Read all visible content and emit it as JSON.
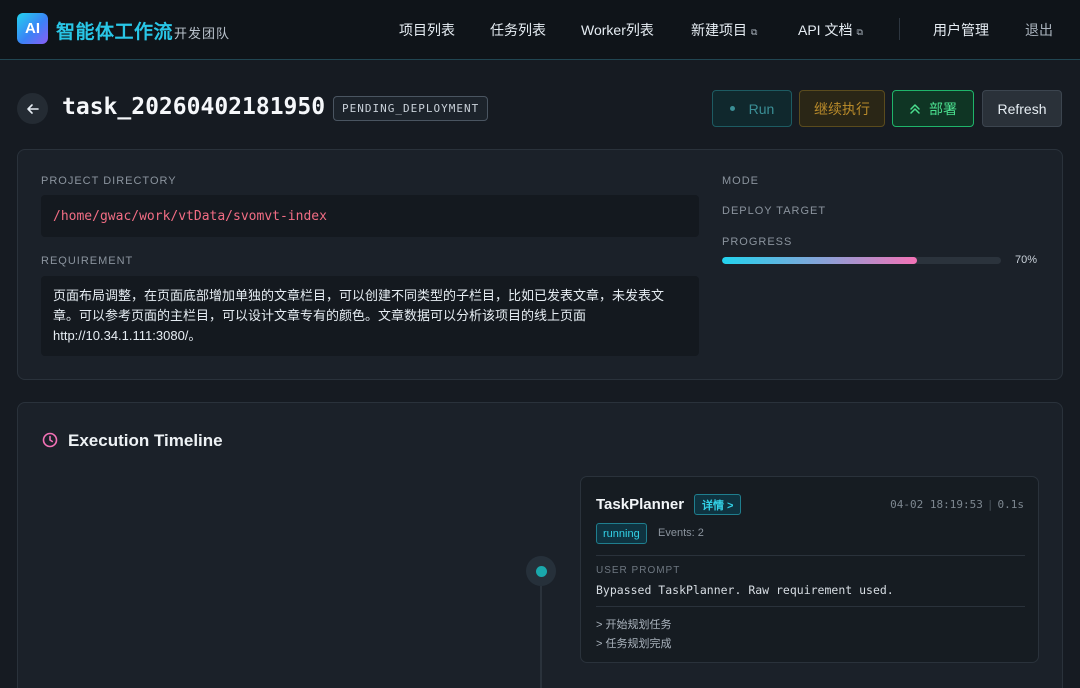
{
  "brand": {
    "logo_text": "AI",
    "title": "智能体工作流",
    "subtitle": "开发团队"
  },
  "nav": {
    "items": [
      {
        "label": "项目列表",
        "external": false
      },
      {
        "label": "任务列表",
        "external": false
      },
      {
        "label": "Worker列表",
        "external": false
      },
      {
        "label": "新建项目",
        "external": true
      },
      {
        "label": "API 文档",
        "external": true
      },
      {
        "label": "用户管理",
        "external": false
      },
      {
        "label": "退出",
        "external": false
      }
    ],
    "external_icon": "⧉"
  },
  "task": {
    "id": "task_20260402181950",
    "status": "PENDING_DEPLOYMENT",
    "actions": {
      "run": "Run",
      "continue": "继续执行",
      "deploy": "部署",
      "refresh": "Refresh"
    }
  },
  "info": {
    "project_directory_label": "PROJECT DIRECTORY",
    "project_directory": "/home/gwac/work/vtData/svomvt-index",
    "requirement_label": "REQUIREMENT",
    "requirement_lines": [
      "页面布局调整，在页面底部增加单独的文章栏目，可以创建不同类型的子栏目，比如已发表文章，未发表文",
      "章。可以参考页面的主栏目，可以设计文章专有的颜色。文章数据可以分析该项目的线上页面",
      "http://10.34.1.111:3080/。"
    ],
    "mode_label": "MODE",
    "mode_value": "",
    "deploy_target_label": "DEPLOY TARGET",
    "deploy_target_value": "",
    "progress_label": "PROGRESS",
    "progress_fraction": 0.7,
    "progress_text": "70%"
  },
  "timeline": {
    "title": "Execution Timeline",
    "icon": "clock-icon",
    "events": [
      {
        "agent": "TaskPlanner",
        "detail_label": "详情 >",
        "timestamp": "04-02 18:19:53",
        "duration": "0.1s",
        "state": "running",
        "events_count": "Events: 2",
        "prompt_label": "USER PROMPT",
        "prompt": "Bypassed TaskPlanner. Raw requirement used.",
        "steps": [
          "> 开始规划任务",
          "> 任务规划完成"
        ]
      }
    ]
  },
  "colors": {
    "accent_cyan": "#22d3ee",
    "accent_pink": "#f472b6",
    "deploy_green": "#4be08f",
    "continue_amber": "#b88a2a",
    "path_pink": "#f26d84"
  }
}
